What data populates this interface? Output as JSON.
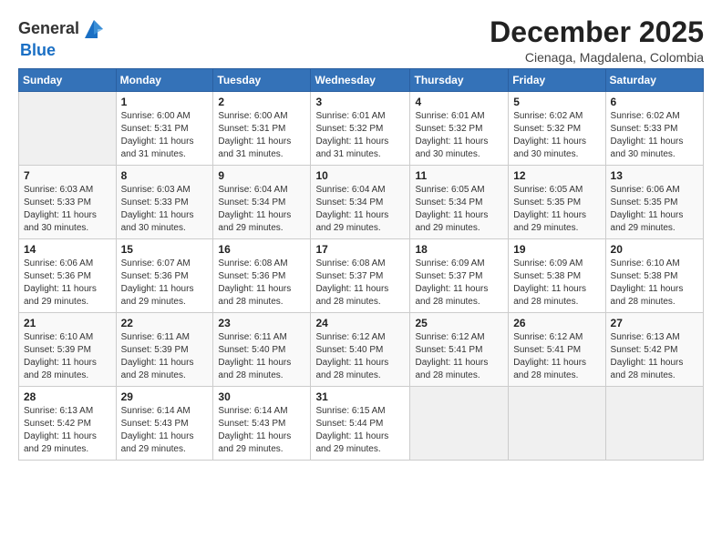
{
  "header": {
    "logo_line1": "General",
    "logo_line2": "Blue",
    "month_title": "December 2025",
    "subtitle": "Cienaga, Magdalena, Colombia"
  },
  "calendar": {
    "days_of_week": [
      "Sunday",
      "Monday",
      "Tuesday",
      "Wednesday",
      "Thursday",
      "Friday",
      "Saturday"
    ],
    "weeks": [
      [
        {
          "day": "",
          "info": ""
        },
        {
          "day": "1",
          "info": "Sunrise: 6:00 AM\nSunset: 5:31 PM\nDaylight: 11 hours and 31 minutes."
        },
        {
          "day": "2",
          "info": "Sunrise: 6:00 AM\nSunset: 5:31 PM\nDaylight: 11 hours and 31 minutes."
        },
        {
          "day": "3",
          "info": "Sunrise: 6:01 AM\nSunset: 5:32 PM\nDaylight: 11 hours and 31 minutes."
        },
        {
          "day": "4",
          "info": "Sunrise: 6:01 AM\nSunset: 5:32 PM\nDaylight: 11 hours and 30 minutes."
        },
        {
          "day": "5",
          "info": "Sunrise: 6:02 AM\nSunset: 5:32 PM\nDaylight: 11 hours and 30 minutes."
        },
        {
          "day": "6",
          "info": "Sunrise: 6:02 AM\nSunset: 5:33 PM\nDaylight: 11 hours and 30 minutes."
        }
      ],
      [
        {
          "day": "7",
          "info": "Sunrise: 6:03 AM\nSunset: 5:33 PM\nDaylight: 11 hours and 30 minutes."
        },
        {
          "day": "8",
          "info": "Sunrise: 6:03 AM\nSunset: 5:33 PM\nDaylight: 11 hours and 30 minutes."
        },
        {
          "day": "9",
          "info": "Sunrise: 6:04 AM\nSunset: 5:34 PM\nDaylight: 11 hours and 29 minutes."
        },
        {
          "day": "10",
          "info": "Sunrise: 6:04 AM\nSunset: 5:34 PM\nDaylight: 11 hours and 29 minutes."
        },
        {
          "day": "11",
          "info": "Sunrise: 6:05 AM\nSunset: 5:34 PM\nDaylight: 11 hours and 29 minutes."
        },
        {
          "day": "12",
          "info": "Sunrise: 6:05 AM\nSunset: 5:35 PM\nDaylight: 11 hours and 29 minutes."
        },
        {
          "day": "13",
          "info": "Sunrise: 6:06 AM\nSunset: 5:35 PM\nDaylight: 11 hours and 29 minutes."
        }
      ],
      [
        {
          "day": "14",
          "info": "Sunrise: 6:06 AM\nSunset: 5:36 PM\nDaylight: 11 hours and 29 minutes."
        },
        {
          "day": "15",
          "info": "Sunrise: 6:07 AM\nSunset: 5:36 PM\nDaylight: 11 hours and 29 minutes."
        },
        {
          "day": "16",
          "info": "Sunrise: 6:08 AM\nSunset: 5:36 PM\nDaylight: 11 hours and 28 minutes."
        },
        {
          "day": "17",
          "info": "Sunrise: 6:08 AM\nSunset: 5:37 PM\nDaylight: 11 hours and 28 minutes."
        },
        {
          "day": "18",
          "info": "Sunrise: 6:09 AM\nSunset: 5:37 PM\nDaylight: 11 hours and 28 minutes."
        },
        {
          "day": "19",
          "info": "Sunrise: 6:09 AM\nSunset: 5:38 PM\nDaylight: 11 hours and 28 minutes."
        },
        {
          "day": "20",
          "info": "Sunrise: 6:10 AM\nSunset: 5:38 PM\nDaylight: 11 hours and 28 minutes."
        }
      ],
      [
        {
          "day": "21",
          "info": "Sunrise: 6:10 AM\nSunset: 5:39 PM\nDaylight: 11 hours and 28 minutes."
        },
        {
          "day": "22",
          "info": "Sunrise: 6:11 AM\nSunset: 5:39 PM\nDaylight: 11 hours and 28 minutes."
        },
        {
          "day": "23",
          "info": "Sunrise: 6:11 AM\nSunset: 5:40 PM\nDaylight: 11 hours and 28 minutes."
        },
        {
          "day": "24",
          "info": "Sunrise: 6:12 AM\nSunset: 5:40 PM\nDaylight: 11 hours and 28 minutes."
        },
        {
          "day": "25",
          "info": "Sunrise: 6:12 AM\nSunset: 5:41 PM\nDaylight: 11 hours and 28 minutes."
        },
        {
          "day": "26",
          "info": "Sunrise: 6:12 AM\nSunset: 5:41 PM\nDaylight: 11 hours and 28 minutes."
        },
        {
          "day": "27",
          "info": "Sunrise: 6:13 AM\nSunset: 5:42 PM\nDaylight: 11 hours and 28 minutes."
        }
      ],
      [
        {
          "day": "28",
          "info": "Sunrise: 6:13 AM\nSunset: 5:42 PM\nDaylight: 11 hours and 29 minutes."
        },
        {
          "day": "29",
          "info": "Sunrise: 6:14 AM\nSunset: 5:43 PM\nDaylight: 11 hours and 29 minutes."
        },
        {
          "day": "30",
          "info": "Sunrise: 6:14 AM\nSunset: 5:43 PM\nDaylight: 11 hours and 29 minutes."
        },
        {
          "day": "31",
          "info": "Sunrise: 6:15 AM\nSunset: 5:44 PM\nDaylight: 11 hours and 29 minutes."
        },
        {
          "day": "",
          "info": ""
        },
        {
          "day": "",
          "info": ""
        },
        {
          "day": "",
          "info": ""
        }
      ]
    ]
  }
}
